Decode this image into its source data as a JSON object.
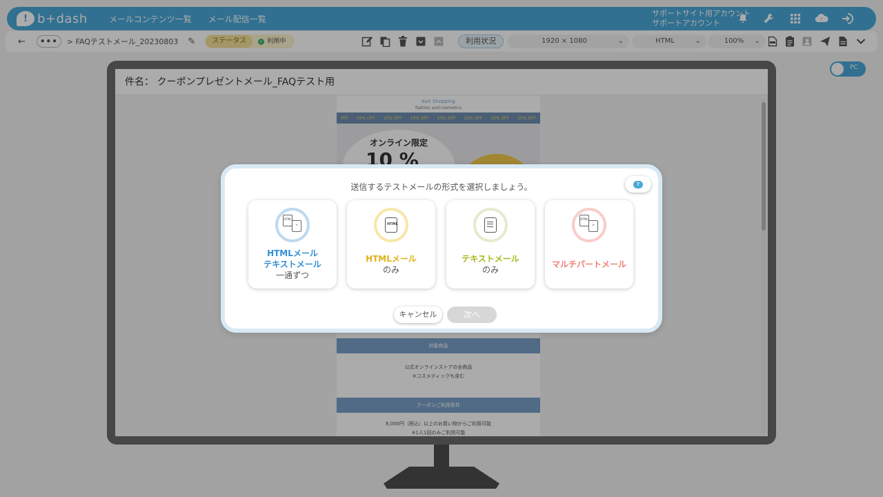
{
  "header": {
    "logo_text": "b+dash",
    "nav": [
      "メールコンテンツ一覧",
      "メール配信一覧"
    ],
    "account_line1": "サポートサイト用アカウント",
    "account_line2": "サポートアカウント",
    "icons": [
      "bell-icon",
      "wrench-icon",
      "apps-grid-icon",
      "help-cloud-icon",
      "logout-icon"
    ]
  },
  "toolbar": {
    "more_label": "•••",
    "breadcrumb": "> FAQテストメール_20230803",
    "status_label": "ステータス",
    "status_value": "利用中",
    "usage_label": "利用状況",
    "resolution": "1920 × 1080",
    "format": "HTML",
    "zoom": "100%"
  },
  "device_toggle": {
    "label": "PC"
  },
  "preview": {
    "subject": "件名： クーポンプレゼントメール_FAQテスト用",
    "brand": "daX Shopping",
    "brand_sub": "fashion and cosmetics",
    "strip_items": [
      "0FF",
      "10% OFF",
      "10% OFF",
      "10% OFF",
      "10% OFF",
      "10% OFF",
      "10% OFF",
      "10% OFF"
    ],
    "hero_title": "オンライン限定",
    "hero_pct": "10 %",
    "section1_head": "対象商品",
    "section1_line1": "公式オンラインストアの全商品",
    "section1_line2": "※コスメティックも含む",
    "section2_head": "クーポンご利用条件",
    "section2_line1": "8,000円（税込）以上のお買い物からご利用可能",
    "section2_line2": "※1人1回のみご利用可能"
  },
  "dialog": {
    "title": "送信するテストメールの形式を選択しましょう。",
    "options": [
      {
        "line1": "HTMLメール",
        "line1b": "テキストメール",
        "line2": "一通ずつ",
        "color": "#2f8fd6",
        "ring": "#bcd9f0"
      },
      {
        "line1": "HTMLメール",
        "line2": "のみ",
        "color": "#e0b21a",
        "ring": "#f7e7a8"
      },
      {
        "line1": "テキストメール",
        "line2": "のみ",
        "color": "#a6b81a",
        "ring": "#e6ead0"
      },
      {
        "line1": "マルチパートメール",
        "color": "#f07f76",
        "ring": "#f8cdca"
      }
    ],
    "cancel_label": "キャンセル",
    "next_label": "次へ"
  }
}
